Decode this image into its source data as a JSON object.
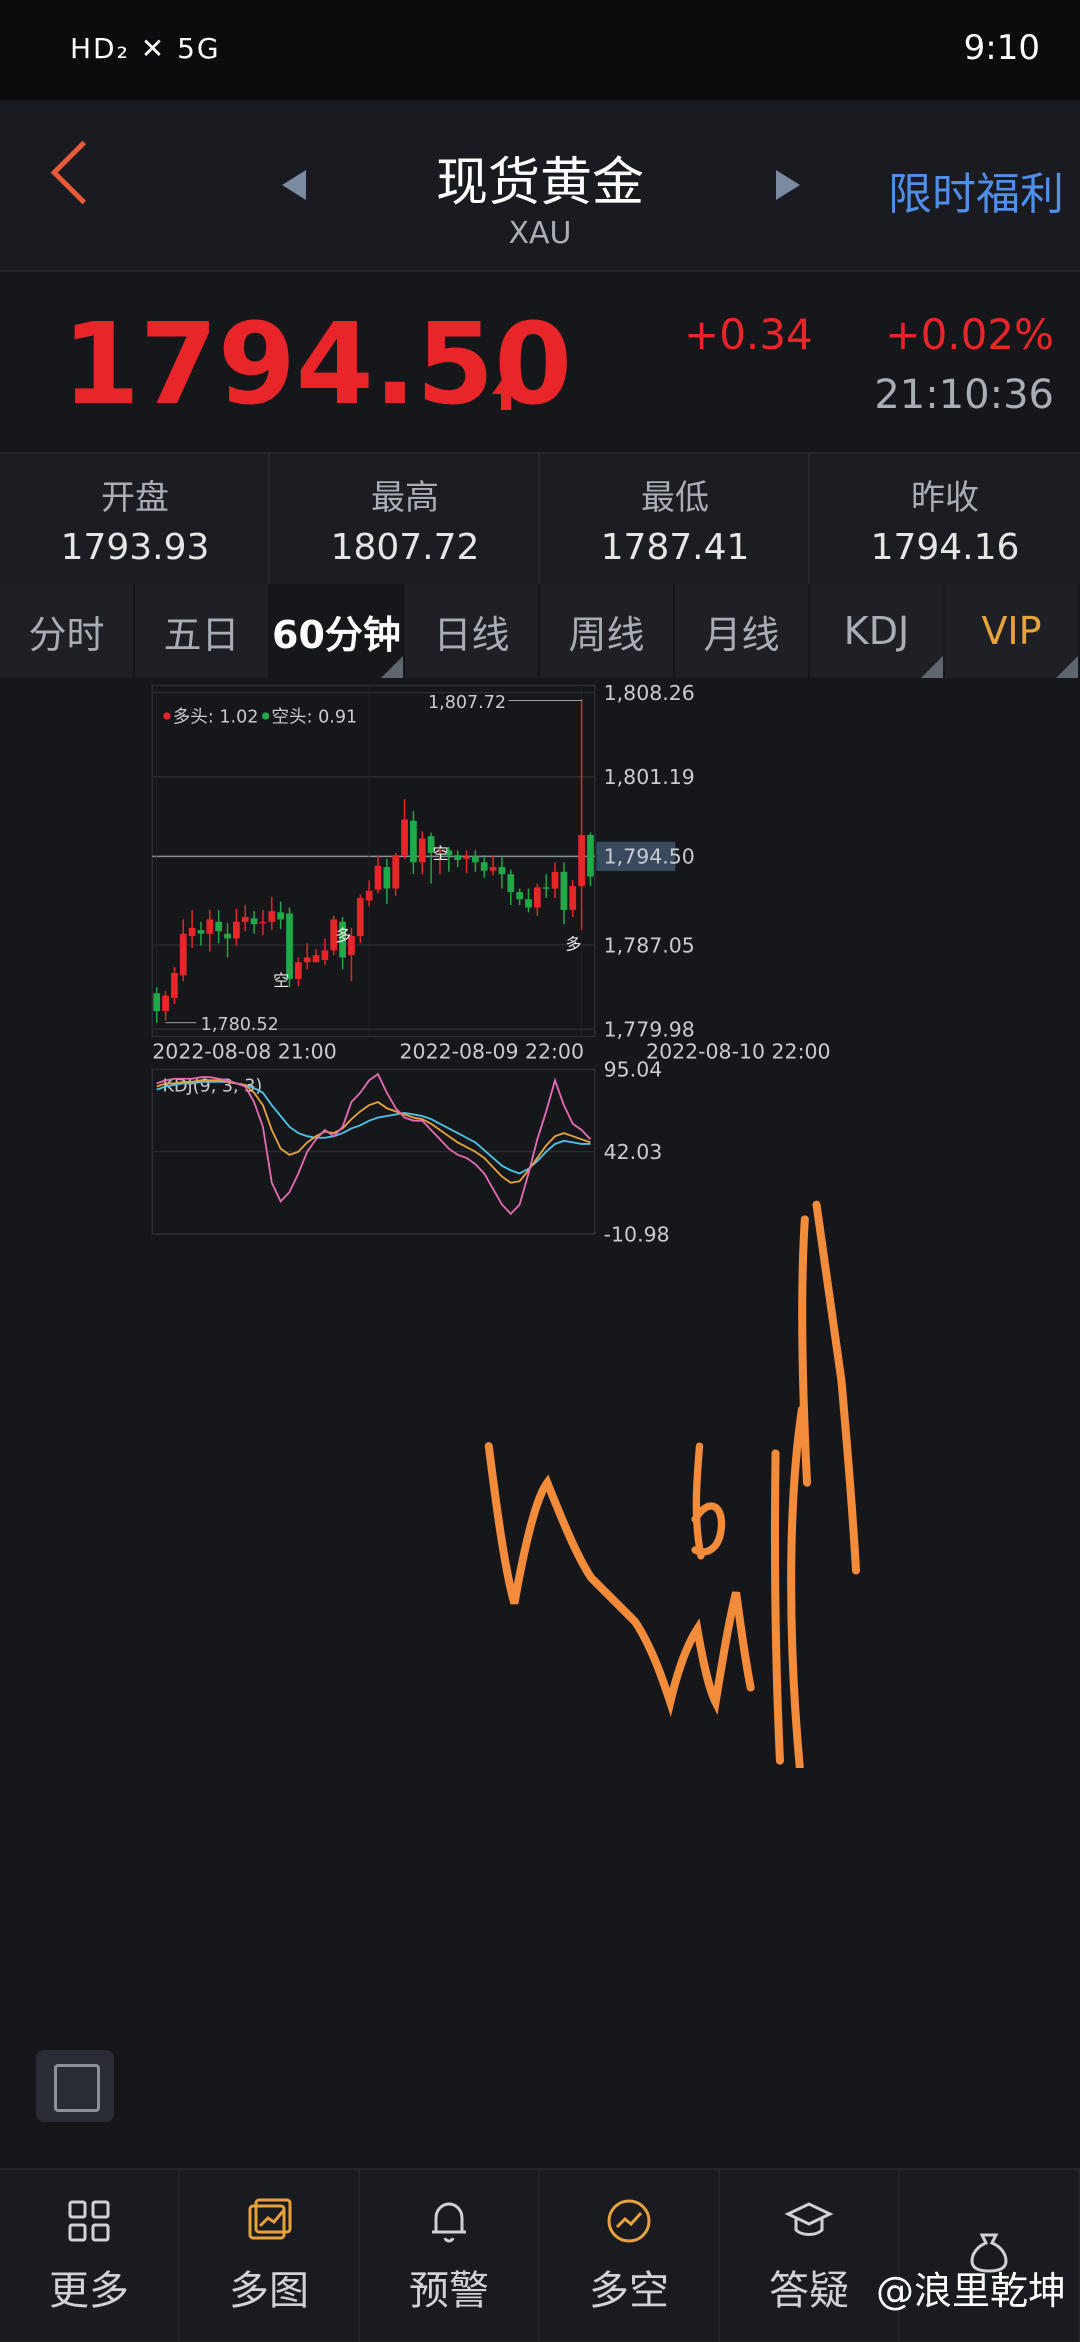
{
  "status_bar": {
    "left": "HD₂ ✕ 5G",
    "time": "9:10"
  },
  "header": {
    "title": "现货黄金",
    "subtitle": "XAU",
    "right_link": "限时福利"
  },
  "quote": {
    "price": "1794.50",
    "change": "+0.34",
    "change_pct": "+0.02%",
    "time": "21:10:36",
    "color_up": "#e8262a"
  },
  "stats": [
    {
      "label": "开盘",
      "value": "1793.93"
    },
    {
      "label": "最高",
      "value": "1807.72"
    },
    {
      "label": "最低",
      "value": "1787.41"
    },
    {
      "label": "昨收",
      "value": "1794.16"
    }
  ],
  "tabs": [
    "分时",
    "五日",
    "60分钟",
    "日线",
    "周线",
    "月线",
    "KDJ",
    "VIP"
  ],
  "active_tab": "60分钟",
  "chart_data": {
    "type": "candlestick",
    "legend": {
      "bull_label": "多头: 1.02",
      "bear_label": "空头: 0.91"
    },
    "y_ticks": [
      "1,808.26",
      "1,801.19",
      "1,794.50",
      "1,787.05",
      "1,779.98"
    ],
    "x_ticks": [
      "2022-08-08 21:00",
      "2022-08-09 22:00",
      "2022-08-10 22:00"
    ],
    "ylim": [
      1779.98,
      1808.26
    ],
    "current": 1794.5,
    "high_label": "1,807.72",
    "low_label": "1,780.52",
    "markers": [
      {
        "text": "空",
        "index": 14,
        "price": 1784.2
      },
      {
        "text": "多",
        "index": 21,
        "price": 1788.0
      },
      {
        "text": "空",
        "index": 32,
        "price": 1794.9
      },
      {
        "text": "多",
        "index": 47,
        "price": 1787.3
      }
    ],
    "candles": [
      [
        1783.0,
        1781.5,
        1783.5,
        1780.5
      ],
      [
        1781.5,
        1782.8,
        1783.2,
        1780.7
      ],
      [
        1782.6,
        1784.7,
        1785.2,
        1782.1
      ],
      [
        1784.5,
        1788.0,
        1789.2,
        1784.0
      ],
      [
        1787.8,
        1788.5,
        1790.0,
        1786.8
      ],
      [
        1788.3,
        1788.0,
        1789.0,
        1787.0
      ],
      [
        1788.0,
        1789.2,
        1790.0,
        1786.5
      ],
      [
        1789.0,
        1788.2,
        1790.0,
        1787.2
      ],
      [
        1788.0,
        1787.6,
        1788.9,
        1786.0
      ],
      [
        1787.6,
        1789.0,
        1790.1,
        1787.0
      ],
      [
        1789.0,
        1789.4,
        1790.4,
        1788.2
      ],
      [
        1789.3,
        1788.8,
        1789.9,
        1788.0
      ],
      [
        1788.9,
        1789.0,
        1790.0,
        1787.9
      ],
      [
        1789.0,
        1789.9,
        1791.1,
        1788.3
      ],
      [
        1789.8,
        1789.2,
        1790.7,
        1788.4
      ],
      [
        1789.7,
        1784.2,
        1790.2,
        1783.5
      ],
      [
        1784.2,
        1785.6,
        1786.0,
        1783.6
      ],
      [
        1785.6,
        1786.0,
        1787.2,
        1785.0
      ],
      [
        1785.6,
        1786.2,
        1786.7,
        1785.6
      ],
      [
        1785.8,
        1786.6,
        1787.6,
        1785.4
      ],
      [
        1786.6,
        1789.2,
        1789.5,
        1786.2
      ],
      [
        1789.0,
        1786.0,
        1789.4,
        1785.0
      ],
      [
        1786.2,
        1787.8,
        1788.5,
        1784.0
      ],
      [
        1787.8,
        1791.0,
        1791.3,
        1787.2
      ],
      [
        1790.8,
        1791.6,
        1792.5,
        1790.3
      ],
      [
        1791.7,
        1793.7,
        1794.6,
        1791.4
      ],
      [
        1793.6,
        1791.8,
        1794.3,
        1790.5
      ],
      [
        1791.8,
        1794.6,
        1794.8,
        1791.2
      ],
      [
        1794.6,
        1797.6,
        1799.3,
        1794.3
      ],
      [
        1797.5,
        1794.0,
        1798.3,
        1793.0
      ],
      [
        1794.0,
        1796.0,
        1796.6,
        1793.0
      ],
      [
        1796.2,
        1794.8,
        1796.5,
        1792.2
      ],
      [
        1794.9,
        1795.0,
        1795.4,
        1793.0
      ],
      [
        1795.0,
        1794.6,
        1795.3,
        1793.2
      ],
      [
        1794.6,
        1794.2,
        1795.0,
        1793.6
      ],
      [
        1794.3,
        1794.5,
        1795.0,
        1793.1
      ],
      [
        1794.5,
        1794.0,
        1795.0,
        1793.2
      ],
      [
        1794.0,
        1793.3,
        1794.6,
        1792.7
      ],
      [
        1793.3,
        1793.6,
        1794.6,
        1792.9
      ],
      [
        1793.6,
        1793.0,
        1794.4,
        1791.8
      ],
      [
        1793.0,
        1791.5,
        1793.4,
        1790.4
      ],
      [
        1791.5,
        1790.9,
        1791.8,
        1790.4
      ],
      [
        1790.9,
        1790.2,
        1791.8,
        1789.8
      ],
      [
        1790.2,
        1791.9,
        1792.2,
        1789.5
      ],
      [
        1791.9,
        1791.8,
        1793.0,
        1791.0
      ],
      [
        1791.8,
        1793.2,
        1794.0,
        1791.0
      ],
      [
        1793.2,
        1790.0,
        1794.0,
        1788.8
      ],
      [
        1790.0,
        1792.0,
        1792.5,
        1789.4
      ],
      [
        1792.0,
        1796.3,
        1807.7,
        1788.3
      ],
      [
        1796.3,
        1792.8,
        1796.5,
        1792.0
      ]
    ]
  },
  "kdj_data": {
    "type": "line",
    "label": "KDJ(9, 3, 3)",
    "y_ticks": [
      "95.04",
      "42.03",
      "-10.98"
    ],
    "ylim": [
      -10.98,
      95.04
    ],
    "series": [
      {
        "color": "#4cc3e8",
        "values": [
          82,
          84,
          85,
          86,
          86,
          87,
          87,
          87,
          87,
          86,
          85,
          83,
          80,
          72,
          65,
          58,
          54,
          52,
          51,
          51,
          52,
          54,
          57,
          59,
          62,
          64,
          65,
          66,
          67,
          66,
          65,
          63,
          60,
          57,
          54,
          51,
          48,
          43,
          38,
          33,
          30,
          28,
          31,
          36,
          42,
          47,
          49,
          48,
          47,
          47
        ]
      },
      {
        "color": "#e8a23a",
        "values": [
          84,
          86,
          86,
          87,
          87,
          88,
          88,
          88,
          87,
          86,
          85,
          80,
          72,
          56,
          44,
          40,
          42,
          48,
          52,
          55,
          54,
          57,
          63,
          68,
          72,
          74,
          70,
          68,
          66,
          64,
          63,
          60,
          56,
          52,
          48,
          45,
          42,
          38,
          32,
          26,
          22,
          23,
          30,
          38,
          46,
          52,
          54,
          52,
          50,
          48
        ]
      },
      {
        "color": "#e46ab5",
        "values": [
          86,
          88,
          89,
          89,
          89,
          90,
          90,
          89,
          88,
          86,
          84,
          74,
          58,
          22,
          10,
          16,
          28,
          42,
          50,
          56,
          52,
          58,
          74,
          80,
          88,
          92,
          80,
          70,
          64,
          62,
          62,
          56,
          50,
          44,
          40,
          38,
          34,
          28,
          18,
          8,
          2,
          8,
          28,
          50,
          68,
          88,
          72,
          60,
          56,
          50
        ]
      }
    ]
  },
  "nav": [
    {
      "label": "更多",
      "icon": "grid-icon"
    },
    {
      "label": "多图",
      "icon": "multi-chart-icon"
    },
    {
      "label": "预警",
      "icon": "bell-icon"
    },
    {
      "label": "多空",
      "icon": "trend-icon"
    },
    {
      "label": "答疑",
      "icon": "mortarboard-icon"
    },
    {
      "label": "",
      "icon": "moneybag-icon"
    }
  ],
  "watermark": "@浪里乾坤"
}
